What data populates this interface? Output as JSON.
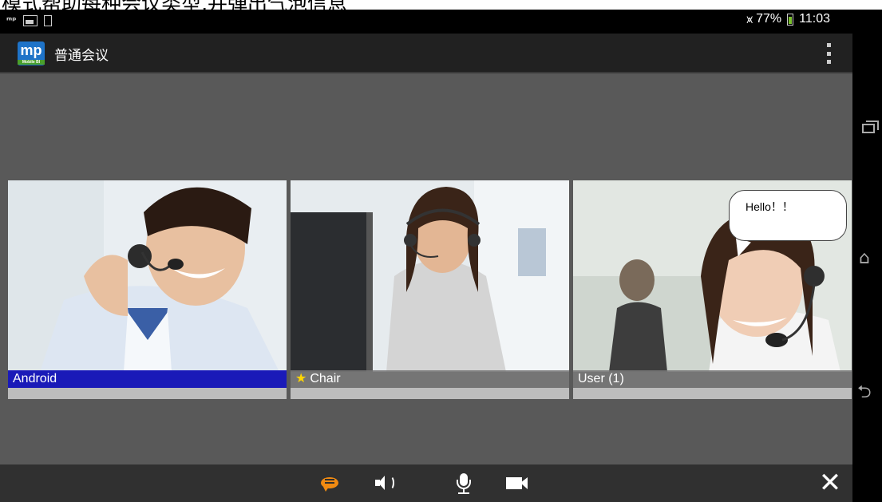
{
  "top_caption": "模式帮助每种会议类型,并弹出气泡信息",
  "status_bar": {
    "left_icons": [
      "mp-notification-icon",
      "image-icon",
      "phone-icon"
    ],
    "wifi_icon": "wifi-icon",
    "battery_percent": "77%",
    "battery_icon": "battery-icon",
    "time": "11:03"
  },
  "action_bar": {
    "logo_text": "mp",
    "logo_subtext": "Mobile BI",
    "title": "普通会议",
    "overflow_icon": "overflow-menu-icon"
  },
  "participants": [
    {
      "name": "Android",
      "active": true,
      "chair": false
    },
    {
      "name": "Chair",
      "active": false,
      "chair": true,
      "badge": "★"
    },
    {
      "name": "User (1)",
      "active": false,
      "chair": false,
      "bubble": "Hello！！"
    }
  ],
  "toolbar": {
    "chat_icon": "chat-icon",
    "speaker_icon": "speaker-icon",
    "mic_icon": "microphone-icon",
    "camera_icon": "video-camera-icon",
    "close_label": "✕"
  },
  "nav_bar": {
    "recent_icon": "recent-apps-icon",
    "home_label": "⌂",
    "back_label": "⮌"
  },
  "colors": {
    "content_bg": "#595959",
    "action_bar_bg": "#212121",
    "active_label_bg": "#1a1ab8",
    "chat_accent": "#f08a12",
    "chair_star": "#ffd600"
  }
}
